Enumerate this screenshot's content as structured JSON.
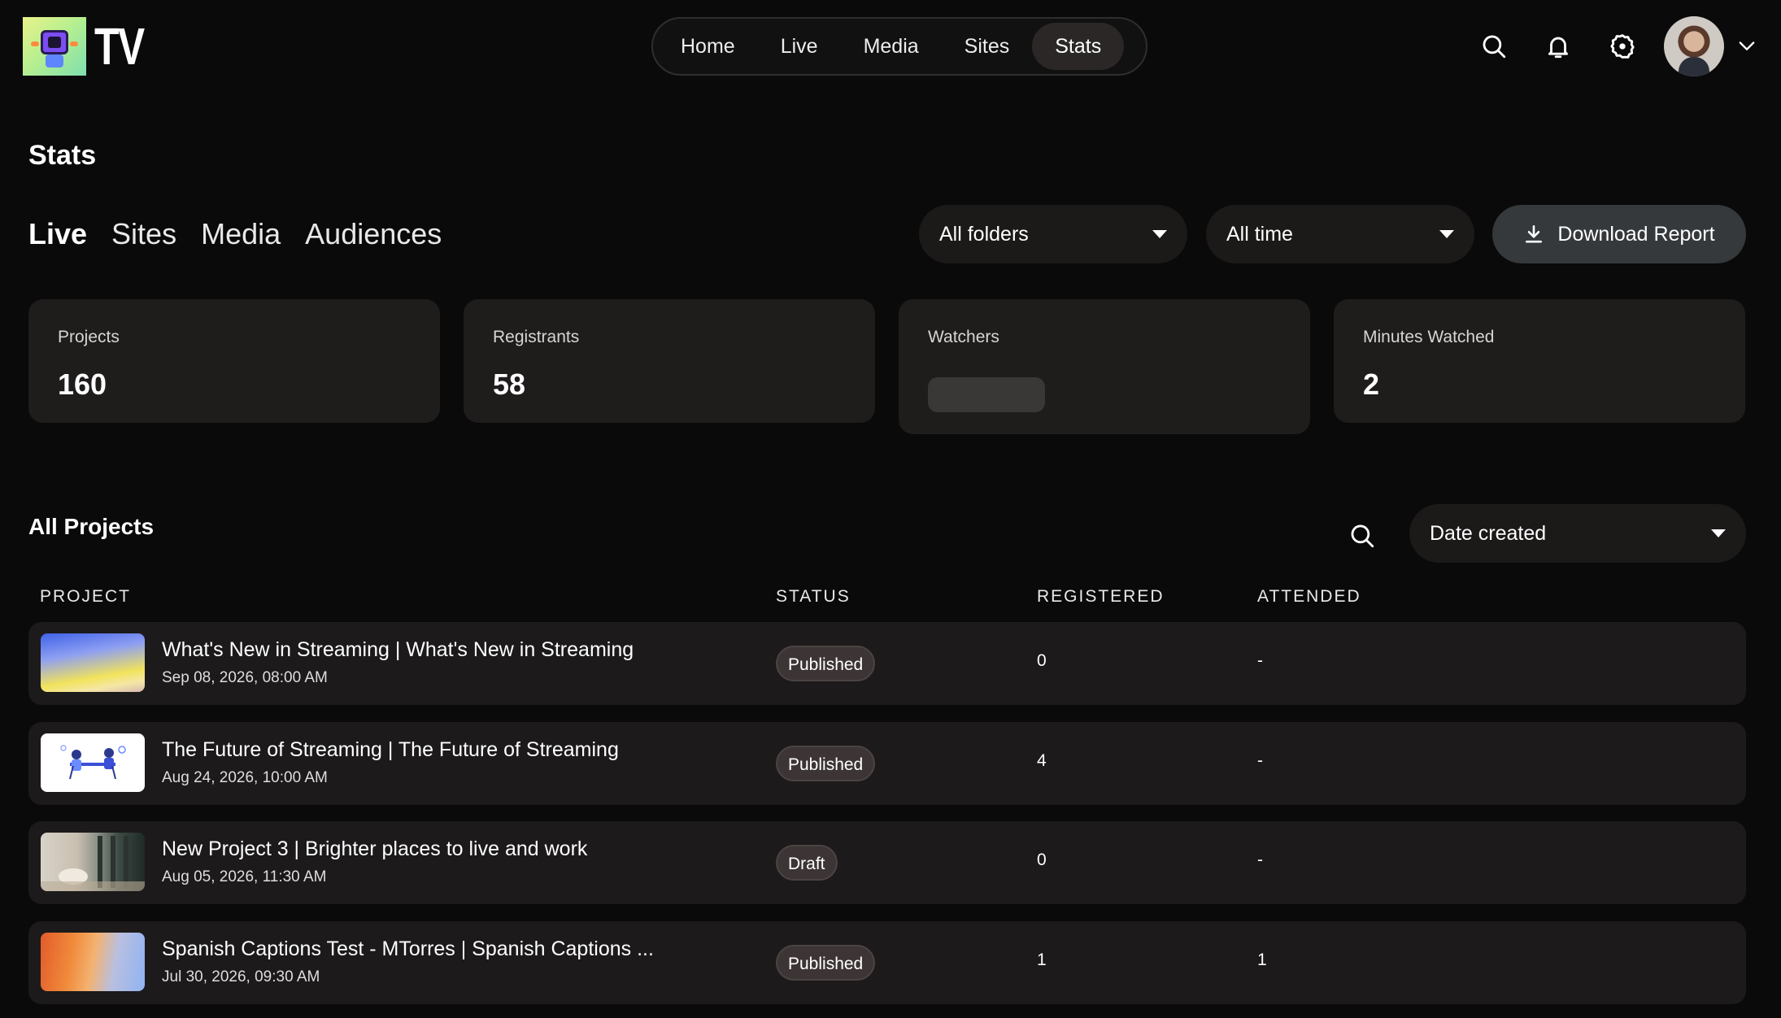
{
  "app": {
    "logo_text": "TV"
  },
  "nav": {
    "items": [
      {
        "label": "Home"
      },
      {
        "label": "Live"
      },
      {
        "label": "Media"
      },
      {
        "label": "Sites"
      },
      {
        "label": "Stats"
      }
    ],
    "active": "Stats"
  },
  "header_icons": [
    "search-icon",
    "bell-icon",
    "gear-icon",
    "avatar",
    "chevron-down-icon"
  ],
  "page": {
    "title": "Stats"
  },
  "subtabs": [
    {
      "label": "Live"
    },
    {
      "label": "Sites"
    },
    {
      "label": "Media"
    },
    {
      "label": "Audiences"
    }
  ],
  "filters": {
    "folder": "All folders",
    "time": "All time",
    "download_label": "Download Report"
  },
  "cards": [
    {
      "label": "Projects",
      "value": "160"
    },
    {
      "label": "Registrants",
      "value": "58"
    },
    {
      "label": "Watchers",
      "value": null
    },
    {
      "label": "Minutes Watched",
      "value": "2"
    }
  ],
  "projects": {
    "title": "All Projects",
    "sort": "Date created",
    "columns": [
      "PROJECT",
      "STATUS",
      "REGISTERED",
      "ATTENDED"
    ],
    "rows": [
      {
        "title": "What's New in Streaming | What's New in Streaming",
        "date": "Sep 08, 2026, 08:00 AM",
        "status": "Published",
        "registered": "0",
        "attended": "-"
      },
      {
        "title": "The Future of Streaming | The Future of Streaming",
        "date": "Aug 24, 2026, 10:00 AM",
        "status": "Published",
        "registered": "4",
        "attended": "-"
      },
      {
        "title": "New Project 3 | Brighter places to live and work",
        "date": "Aug 05, 2026, 11:30 AM",
        "status": "Draft",
        "registered": "0",
        "attended": "-"
      },
      {
        "title": "Spanish Captions Test - MTorres | Spanish Captions ...",
        "date": "Jul 30, 2026, 09:30 AM",
        "status": "Published",
        "registered": "1",
        "attended": "1"
      }
    ]
  },
  "colors": {
    "background": "#0a0a0a",
    "card": "#1f1c1c",
    "row": "#1c1a1a",
    "badge": "#3d3535",
    "button": "#35393b"
  }
}
